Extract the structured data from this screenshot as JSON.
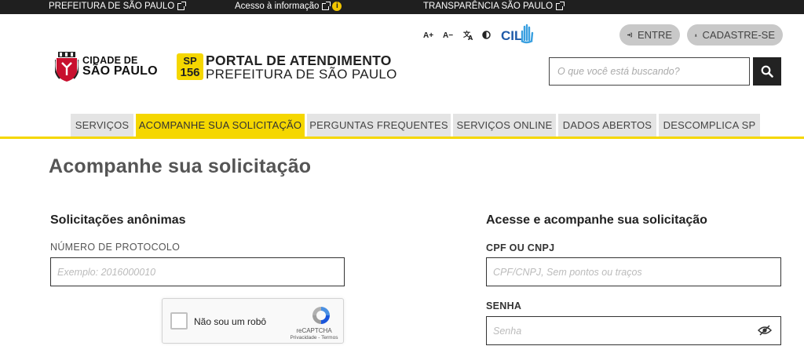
{
  "topbar": {
    "link1": "PREFEITURA DE SÃO PAULO",
    "link2": "Acesso à informação",
    "link3": "TRANSPARÊNCIA SÃO PAULO"
  },
  "accessibility": {
    "font_increase": "A+",
    "font_decrease": "A−",
    "cil_label": "CIL"
  },
  "auth": {
    "login_label": "ENTRE",
    "signup_label": "CADASTRE-SE"
  },
  "brand": {
    "city_line1": "CIDADE DE",
    "city_line2": "SÃO PAULO",
    "badge_line1": "SP",
    "badge_line2": "156",
    "portal_line1": "PORTAL DE ATENDIMENTO",
    "portal_line2": "PREFEITURA DE SÃO PAULO"
  },
  "search": {
    "placeholder": "O que você está buscando?"
  },
  "nav": {
    "items": [
      {
        "label": "SERVIÇOS"
      },
      {
        "label": "ACOMPANHE SUA SOLICITAÇÃO"
      },
      {
        "label": "PERGUNTAS FREQUENTES"
      },
      {
        "label": "SERVIÇOS ONLINE"
      },
      {
        "label": "DADOS ABERTOS"
      },
      {
        "label": "DESCOMPLICA SP"
      }
    ],
    "active_index": 1
  },
  "main": {
    "title": "Acompanhe sua solicitação",
    "anonymous": {
      "title": "Solicitações anônimas",
      "protocol_label": "NÚMERO DE PROTOCOLO",
      "protocol_placeholder": "Exemplo: 2016000010"
    },
    "login": {
      "title": "Acesse e acompanhe sua solicitação",
      "cpf_label": "CPF OU CNPJ",
      "cpf_placeholder": "CPF/CNPJ, Sem pontos ou traços",
      "password_label": "SENHA",
      "password_placeholder": "Senha"
    },
    "recaptcha": {
      "label": "Não sou um robô",
      "brand": "reCAPTCHA",
      "links": "Privacidade - Termos"
    }
  },
  "colors": {
    "accent_yellow": "#f5d700",
    "topbar_bg": "#1f1f1f",
    "nav_bg": "#e4e4e4",
    "pill_bg": "#c8c8c8"
  }
}
